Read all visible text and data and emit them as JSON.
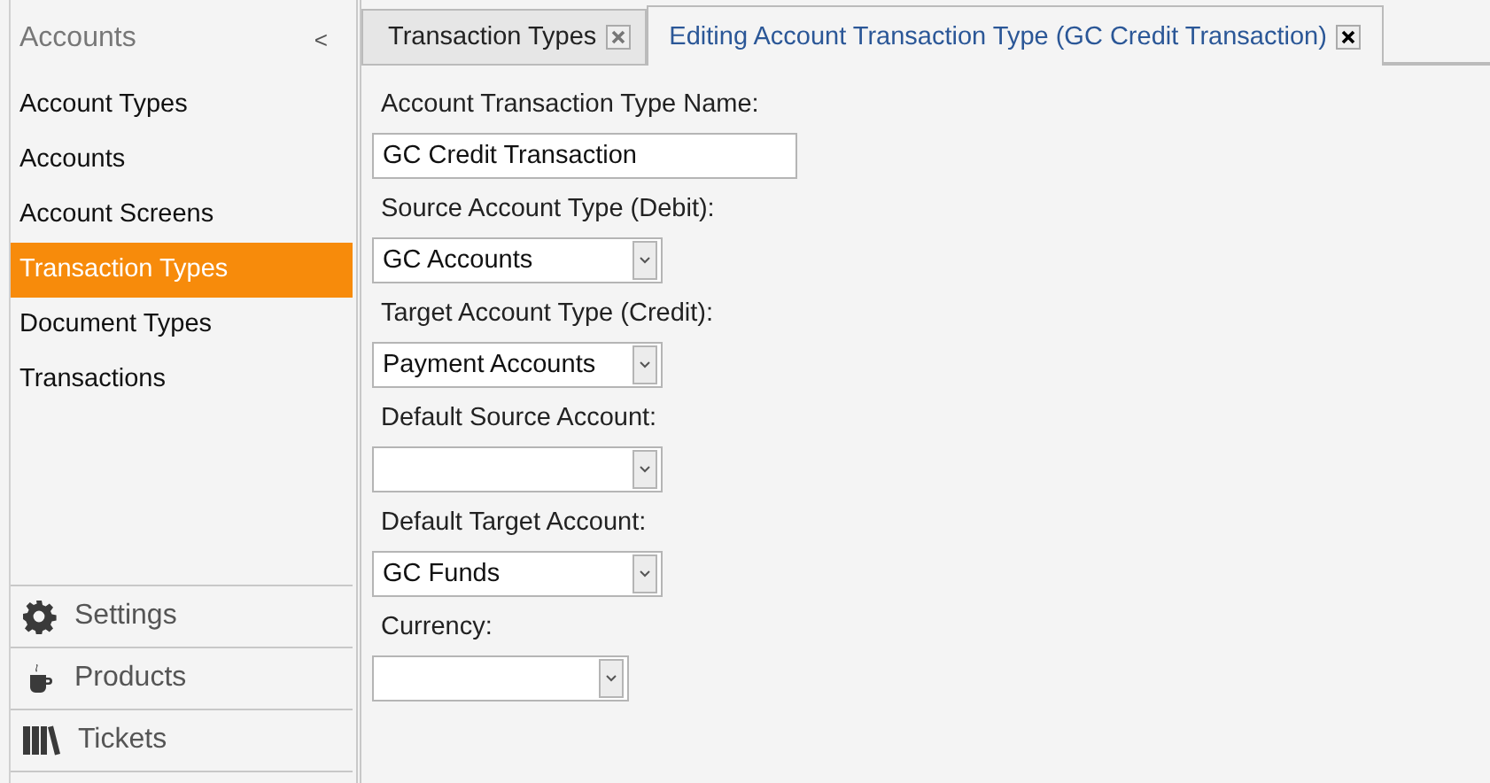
{
  "sidebar": {
    "title": "Accounts",
    "collapse": "<",
    "items": [
      {
        "label": "Account Types",
        "selected": false
      },
      {
        "label": "Accounts",
        "selected": false
      },
      {
        "label": "Account Screens",
        "selected": false
      },
      {
        "label": "Transaction Types",
        "selected": true
      },
      {
        "label": "Document Types",
        "selected": false
      },
      {
        "label": "Transactions",
        "selected": false
      }
    ],
    "sections": [
      {
        "label": "Settings"
      },
      {
        "label": "Products"
      },
      {
        "label": "Tickets"
      }
    ]
  },
  "tabs": [
    {
      "label": "Transaction Types",
      "selected": false
    },
    {
      "label": "Editing Account Transaction Type (GC Credit Transaction)",
      "selected": true
    }
  ],
  "form": {
    "fields": [
      {
        "label": "Account Transaction Type Name:",
        "kind": "text",
        "value": "GC Credit Transaction"
      },
      {
        "label": "Source Account Type (Debit):",
        "kind": "select",
        "value": "GC Accounts"
      },
      {
        "label": "Target Account Type (Credit):",
        "kind": "select",
        "value": "Payment Accounts"
      },
      {
        "label": "Default Source Account:",
        "kind": "select"
      },
      {
        "label": "Default Target Account:",
        "kind": "select",
        "value": "GC Funds"
      },
      {
        "label": "Currency:",
        "kind": "select"
      }
    ]
  }
}
